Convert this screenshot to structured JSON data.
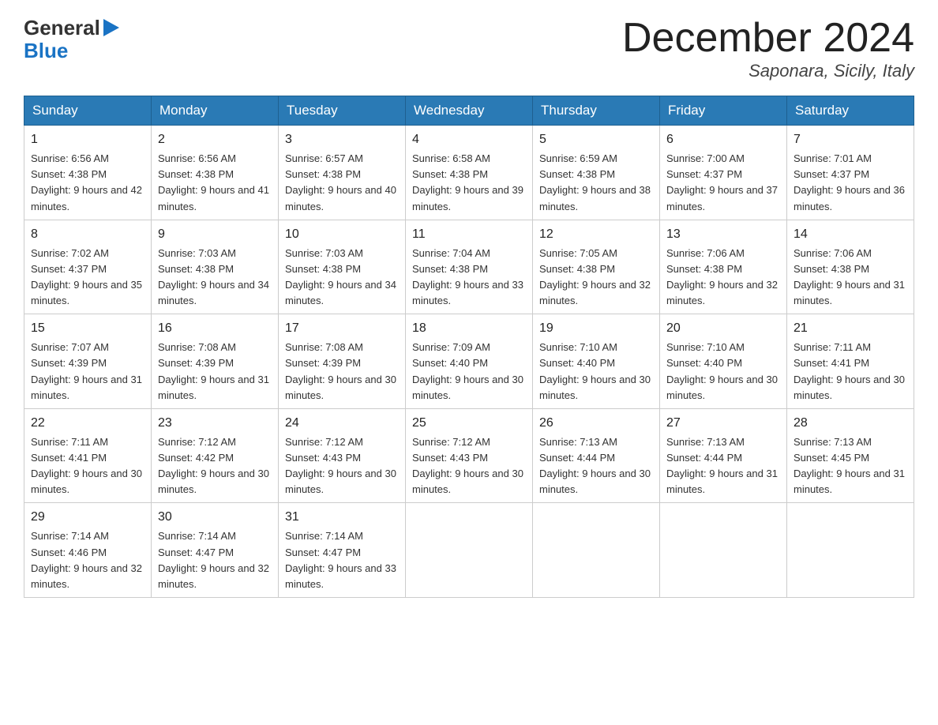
{
  "header": {
    "logo_general": "General",
    "logo_blue": "Blue",
    "month_title": "December 2024",
    "location": "Saponara, Sicily, Italy"
  },
  "calendar": {
    "days_of_week": [
      "Sunday",
      "Monday",
      "Tuesday",
      "Wednesday",
      "Thursday",
      "Friday",
      "Saturday"
    ],
    "weeks": [
      [
        {
          "day": "1",
          "sunrise": "6:56 AM",
          "sunset": "4:38 PM",
          "daylight": "9 hours and 42 minutes."
        },
        {
          "day": "2",
          "sunrise": "6:56 AM",
          "sunset": "4:38 PM",
          "daylight": "9 hours and 41 minutes."
        },
        {
          "day": "3",
          "sunrise": "6:57 AM",
          "sunset": "4:38 PM",
          "daylight": "9 hours and 40 minutes."
        },
        {
          "day": "4",
          "sunrise": "6:58 AM",
          "sunset": "4:38 PM",
          "daylight": "9 hours and 39 minutes."
        },
        {
          "day": "5",
          "sunrise": "6:59 AM",
          "sunset": "4:38 PM",
          "daylight": "9 hours and 38 minutes."
        },
        {
          "day": "6",
          "sunrise": "7:00 AM",
          "sunset": "4:37 PM",
          "daylight": "9 hours and 37 minutes."
        },
        {
          "day": "7",
          "sunrise": "7:01 AM",
          "sunset": "4:37 PM",
          "daylight": "9 hours and 36 minutes."
        }
      ],
      [
        {
          "day": "8",
          "sunrise": "7:02 AM",
          "sunset": "4:37 PM",
          "daylight": "9 hours and 35 minutes."
        },
        {
          "day": "9",
          "sunrise": "7:03 AM",
          "sunset": "4:38 PM",
          "daylight": "9 hours and 34 minutes."
        },
        {
          "day": "10",
          "sunrise": "7:03 AM",
          "sunset": "4:38 PM",
          "daylight": "9 hours and 34 minutes."
        },
        {
          "day": "11",
          "sunrise": "7:04 AM",
          "sunset": "4:38 PM",
          "daylight": "9 hours and 33 minutes."
        },
        {
          "day": "12",
          "sunrise": "7:05 AM",
          "sunset": "4:38 PM",
          "daylight": "9 hours and 32 minutes."
        },
        {
          "day": "13",
          "sunrise": "7:06 AM",
          "sunset": "4:38 PM",
          "daylight": "9 hours and 32 minutes."
        },
        {
          "day": "14",
          "sunrise": "7:06 AM",
          "sunset": "4:38 PM",
          "daylight": "9 hours and 31 minutes."
        }
      ],
      [
        {
          "day": "15",
          "sunrise": "7:07 AM",
          "sunset": "4:39 PM",
          "daylight": "9 hours and 31 minutes."
        },
        {
          "day": "16",
          "sunrise": "7:08 AM",
          "sunset": "4:39 PM",
          "daylight": "9 hours and 31 minutes."
        },
        {
          "day": "17",
          "sunrise": "7:08 AM",
          "sunset": "4:39 PM",
          "daylight": "9 hours and 30 minutes."
        },
        {
          "day": "18",
          "sunrise": "7:09 AM",
          "sunset": "4:40 PM",
          "daylight": "9 hours and 30 minutes."
        },
        {
          "day": "19",
          "sunrise": "7:10 AM",
          "sunset": "4:40 PM",
          "daylight": "9 hours and 30 minutes."
        },
        {
          "day": "20",
          "sunrise": "7:10 AM",
          "sunset": "4:40 PM",
          "daylight": "9 hours and 30 minutes."
        },
        {
          "day": "21",
          "sunrise": "7:11 AM",
          "sunset": "4:41 PM",
          "daylight": "9 hours and 30 minutes."
        }
      ],
      [
        {
          "day": "22",
          "sunrise": "7:11 AM",
          "sunset": "4:41 PM",
          "daylight": "9 hours and 30 minutes."
        },
        {
          "day": "23",
          "sunrise": "7:12 AM",
          "sunset": "4:42 PM",
          "daylight": "9 hours and 30 minutes."
        },
        {
          "day": "24",
          "sunrise": "7:12 AM",
          "sunset": "4:43 PM",
          "daylight": "9 hours and 30 minutes."
        },
        {
          "day": "25",
          "sunrise": "7:12 AM",
          "sunset": "4:43 PM",
          "daylight": "9 hours and 30 minutes."
        },
        {
          "day": "26",
          "sunrise": "7:13 AM",
          "sunset": "4:44 PM",
          "daylight": "9 hours and 30 minutes."
        },
        {
          "day": "27",
          "sunrise": "7:13 AM",
          "sunset": "4:44 PM",
          "daylight": "9 hours and 31 minutes."
        },
        {
          "day": "28",
          "sunrise": "7:13 AM",
          "sunset": "4:45 PM",
          "daylight": "9 hours and 31 minutes."
        }
      ],
      [
        {
          "day": "29",
          "sunrise": "7:14 AM",
          "sunset": "4:46 PM",
          "daylight": "9 hours and 32 minutes."
        },
        {
          "day": "30",
          "sunrise": "7:14 AM",
          "sunset": "4:47 PM",
          "daylight": "9 hours and 32 minutes."
        },
        {
          "day": "31",
          "sunrise": "7:14 AM",
          "sunset": "4:47 PM",
          "daylight": "9 hours and 33 minutes."
        },
        null,
        null,
        null,
        null
      ]
    ]
  }
}
